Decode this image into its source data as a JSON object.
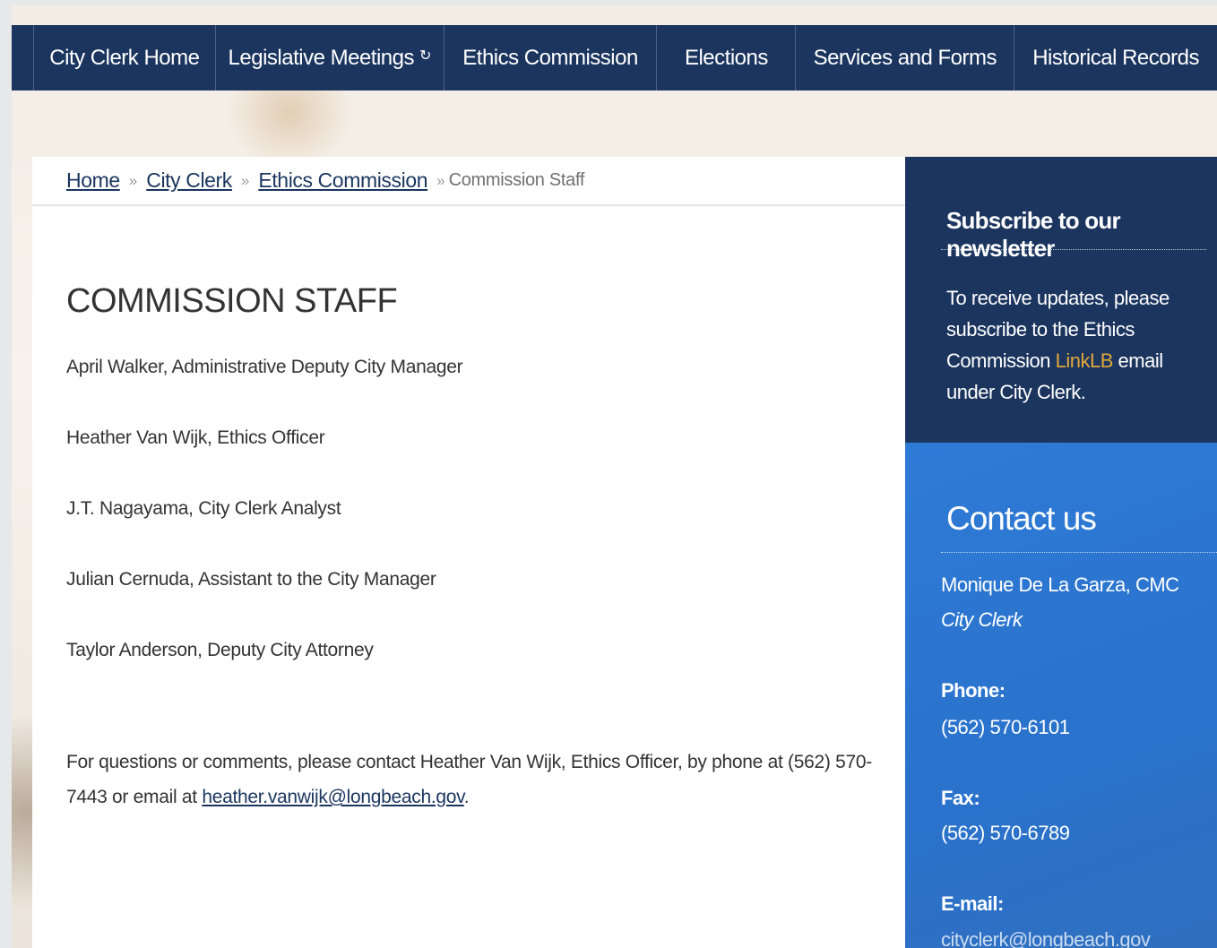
{
  "nav": {
    "items": [
      {
        "label": "City Clerk Home"
      },
      {
        "label": "Legislative Meetings",
        "external_icon": "external-link-icon"
      },
      {
        "label": "Ethics Commission"
      },
      {
        "label": "Elections"
      },
      {
        "label": "Services and Forms"
      },
      {
        "label": "Historical Records"
      }
    ]
  },
  "breadcrumb": {
    "home": "Home",
    "city_clerk": "City Clerk",
    "ethics_commission": "Ethics Commission",
    "separator": "»",
    "current": "Commission Staff"
  },
  "main": {
    "title": "COMMISSION STAFF",
    "staff": [
      "April Walker, Administrative Deputy City Manager",
      "Heather Van Wijk, Ethics Officer",
      "J.T. Nagayama, City Clerk Analyst",
      "Julian Cernuda, Assistant to the City Manager",
      "Taylor Anderson, Deputy City Attorney"
    ],
    "contact_note_prefix": "For questions or comments, please contact Heather Van Wijk, Ethics Officer, by phone at (562) 570-7443 or email at ",
    "contact_email": "heather.vanwijk@longbeach.gov",
    "contact_note_suffix": "."
  },
  "sidebar": {
    "newsletter": {
      "title": "Subscribe to our newsletter",
      "text_before": "To receive updates, please subscribe to the Ethics Commission ",
      "link": "LinkLB",
      "text_after": " email under City Clerk."
    },
    "contact": {
      "title": "Contact us",
      "name": "Monique De La Garza, CMC",
      "role": "City Clerk",
      "phone_label": "Phone:",
      "phone": "(562) 570-6101",
      "fax_label": "Fax:",
      "fax": "(562) 570-6789",
      "email_label": "E-mail:",
      "email": "cityclerk@longbeach.gov"
    }
  },
  "colors": {
    "nav_bg": "#1b355f",
    "contact_bg": "#2e7bd6",
    "link_accent": "#e2a63b"
  }
}
